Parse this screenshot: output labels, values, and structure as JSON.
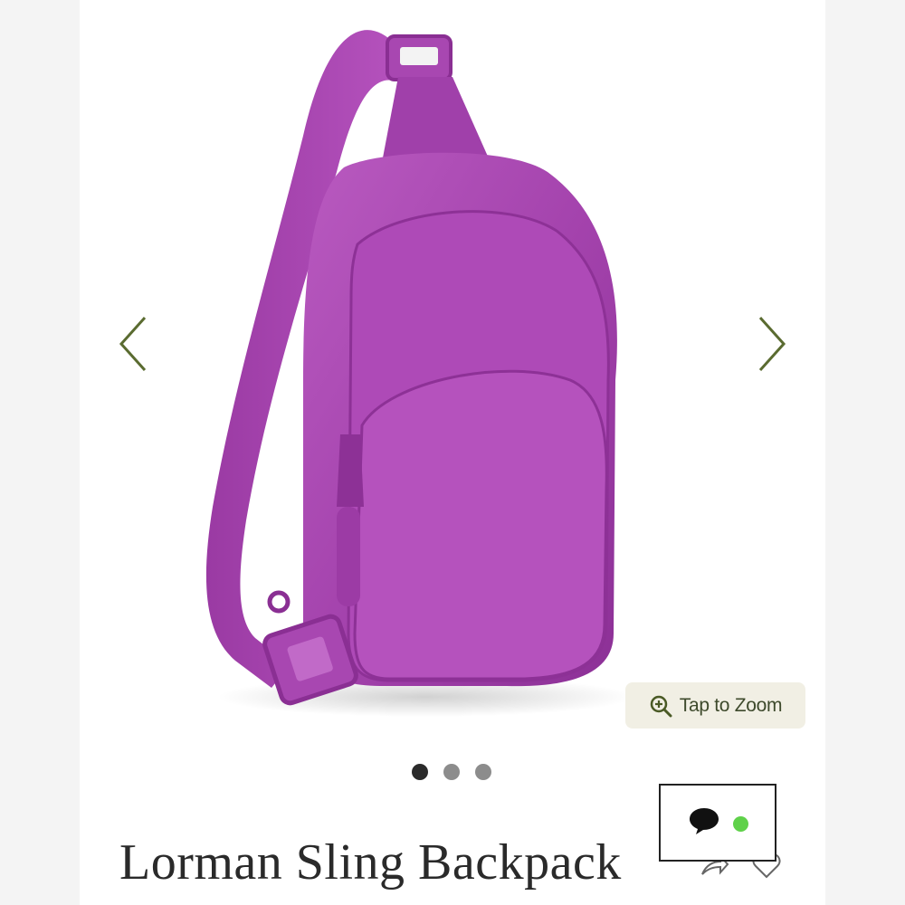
{
  "product": {
    "title": "Lorman Sling Backpack",
    "image_color": "#a63fb0"
  },
  "gallery": {
    "prev_icon": "chevron-left-icon",
    "next_icon": "chevron-right-icon",
    "arrow_color": "#5a6b30",
    "zoom_label": "Tap to Zoom",
    "zoom_icon": "zoom-in-icon",
    "zoom_bg": "#f1efe4",
    "dots": [
      {
        "active": true,
        "color": "#2b2b2b"
      },
      {
        "active": false,
        "color": "#8c8c8c"
      },
      {
        "active": false,
        "color": "#8c8c8c"
      }
    ]
  },
  "actions": {
    "share_icon": "share-icon",
    "wishlist_icon": "heart-icon"
  },
  "chat": {
    "icon": "chat-bubble-icon",
    "status_color": "#5fd14a"
  }
}
